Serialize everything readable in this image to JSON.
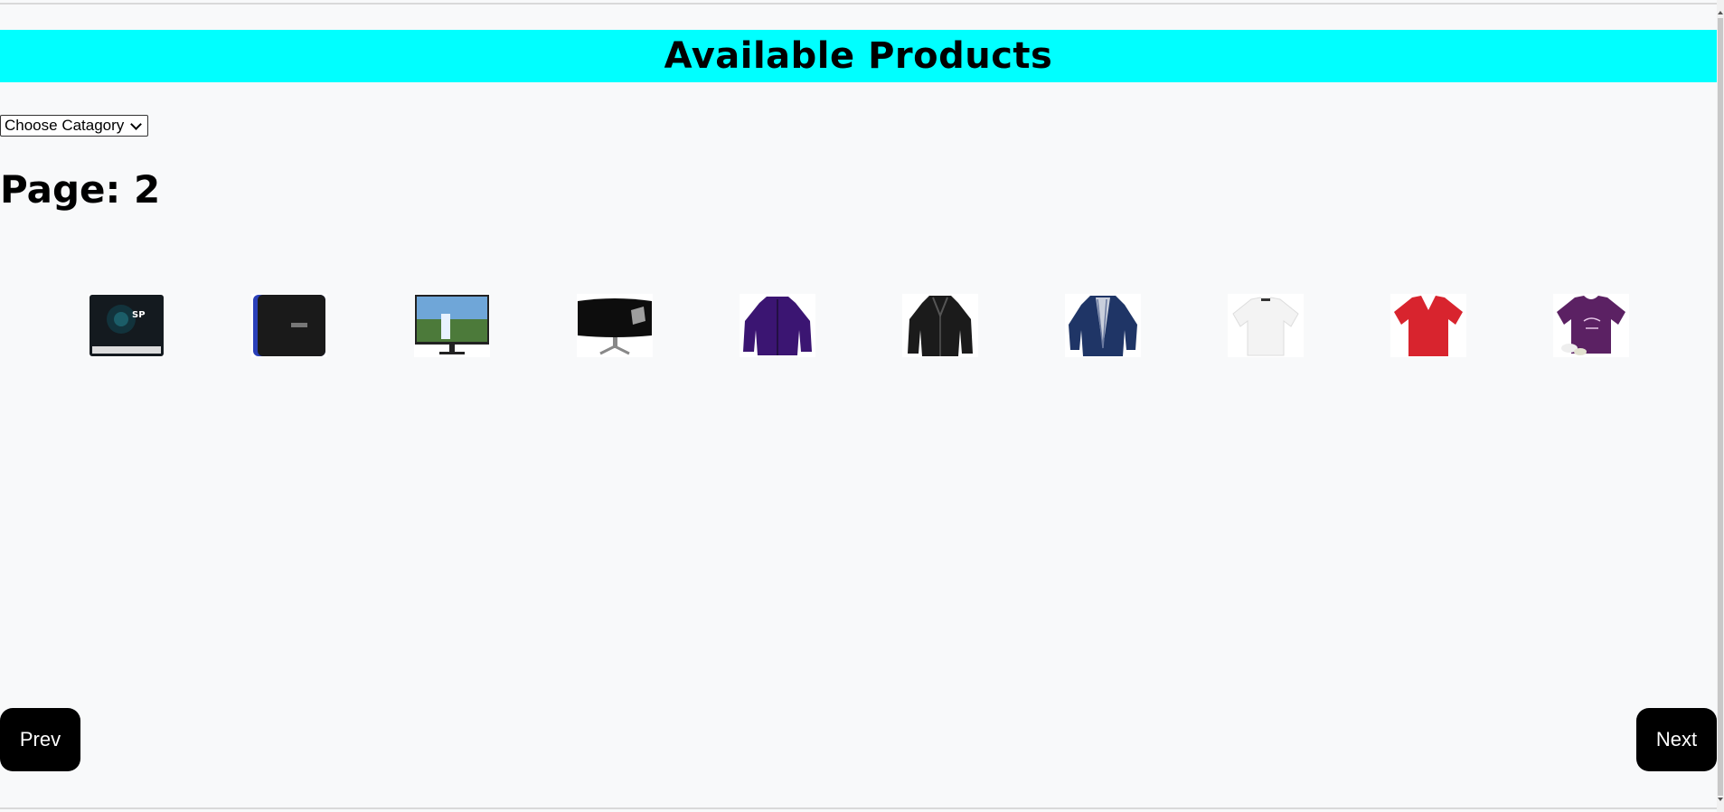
{
  "header": {
    "title": "Available Products"
  },
  "category_select": {
    "selected": "Choose Catagory"
  },
  "pagination": {
    "page_label": "Page: 2",
    "prev_label": "Prev",
    "next_label": "Next"
  },
  "products": [
    {
      "name": "ssd-drive",
      "icon": "ssd-icon"
    },
    {
      "name": "external-hard-drive",
      "icon": "hard-drive-icon"
    },
    {
      "name": "monitor",
      "icon": "monitor-icon"
    },
    {
      "name": "curved-monitor",
      "icon": "curved-monitor-icon"
    },
    {
      "name": "purple-jacket",
      "icon": "jacket-icon"
    },
    {
      "name": "black-leather-jacket",
      "icon": "jacket-icon"
    },
    {
      "name": "navy-blazer",
      "icon": "blazer-icon"
    },
    {
      "name": "white-tshirt",
      "icon": "tshirt-icon"
    },
    {
      "name": "red-tshirt",
      "icon": "tshirt-icon"
    },
    {
      "name": "purple-tshirt",
      "icon": "tshirt-icon"
    }
  ],
  "colors": {
    "header_bg": "#00ffff",
    "page_bg": "#f8f9fa",
    "button_bg": "#000000"
  }
}
